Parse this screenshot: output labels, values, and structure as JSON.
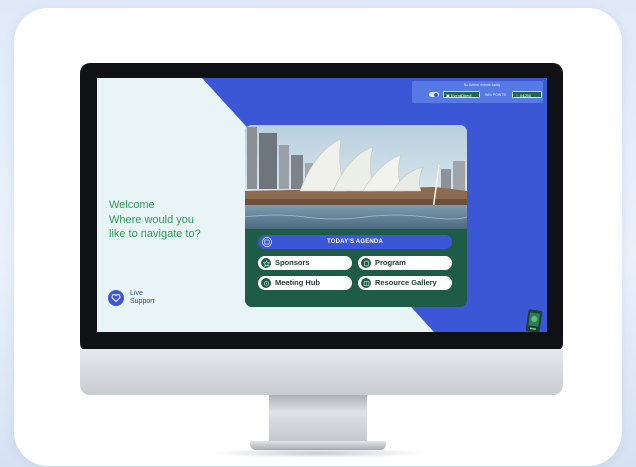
{
  "screen": {
    "welcome_lines": [
      "Welcome",
      "Where would you",
      "like to navigate to?"
    ],
    "live_support": {
      "line1": "Live",
      "line2": "Support"
    },
    "topbar": {
      "message": "No further events today",
      "chip_left": "EventDirect",
      "points_label": "WIN POINTS",
      "points_value": "04250"
    },
    "agenda_label": "TODAY'S AGENDA",
    "buttons": {
      "sponsors": "Sponsors",
      "program": "Program",
      "meeting_hub": "Meeting Hub",
      "resource_gallery": "Resource Gallery"
    }
  },
  "colors": {
    "accent_blue": "#3b57d6",
    "panel_green": "#1f5c48",
    "welcome_green": "#2d9a58",
    "screen_bg": "#e8f4f5"
  },
  "icons": [
    "live-support-heart-icon",
    "calendar-icon",
    "star-icon",
    "program-icon",
    "meeting-icon",
    "gallery-icon",
    "toggle-icon",
    "chat-icon",
    "wifi-icon"
  ]
}
